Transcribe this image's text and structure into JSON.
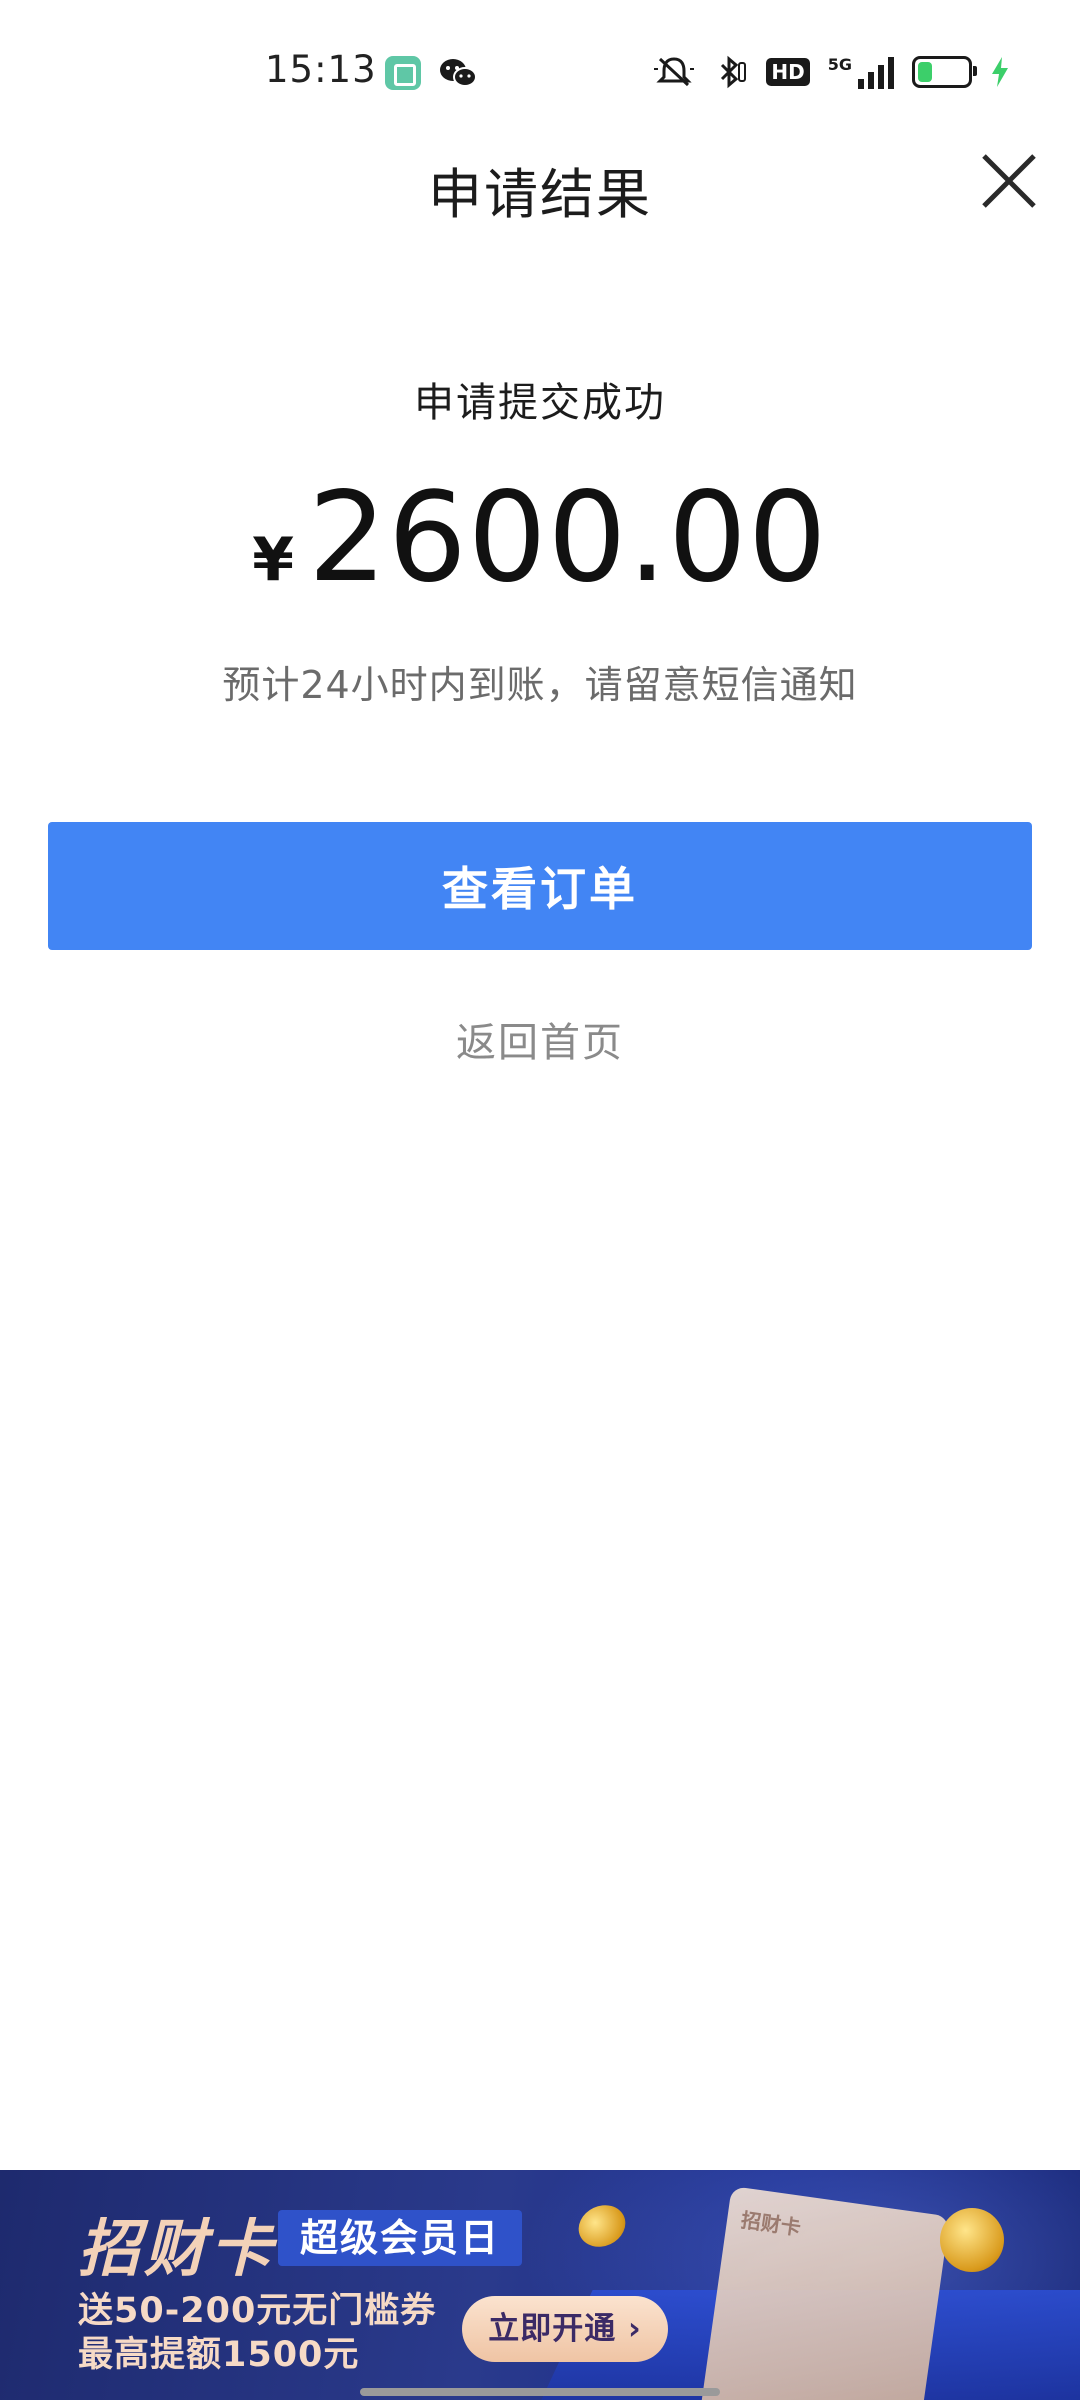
{
  "status_bar": {
    "time": "15:13",
    "hd": "HD",
    "network": "5G",
    "icons": [
      "gallery-app-icon",
      "wechat-icon",
      "mute-icon",
      "bluetooth-icon",
      "hd-icon",
      "signal-icon",
      "battery-icon",
      "charging-icon"
    ]
  },
  "header": {
    "title": "申请结果",
    "close_icon": "close-icon"
  },
  "result": {
    "status": "申请提交成功",
    "currency": "¥",
    "amount": "2600.00",
    "hint": "预计24小时内到账，请留意短信通知"
  },
  "actions": {
    "view_order": "查看订单",
    "back_home": "返回首页"
  },
  "banner": {
    "brand": "招财卡",
    "tag": "超级会员日",
    "line1": "送50-200元无门槛券",
    "line2": "最高提额1500元",
    "button": "立即开通 ›",
    "card_label": "招财卡"
  },
  "colors": {
    "primary": "#4285f4",
    "banner_bg": "#23338a"
  }
}
